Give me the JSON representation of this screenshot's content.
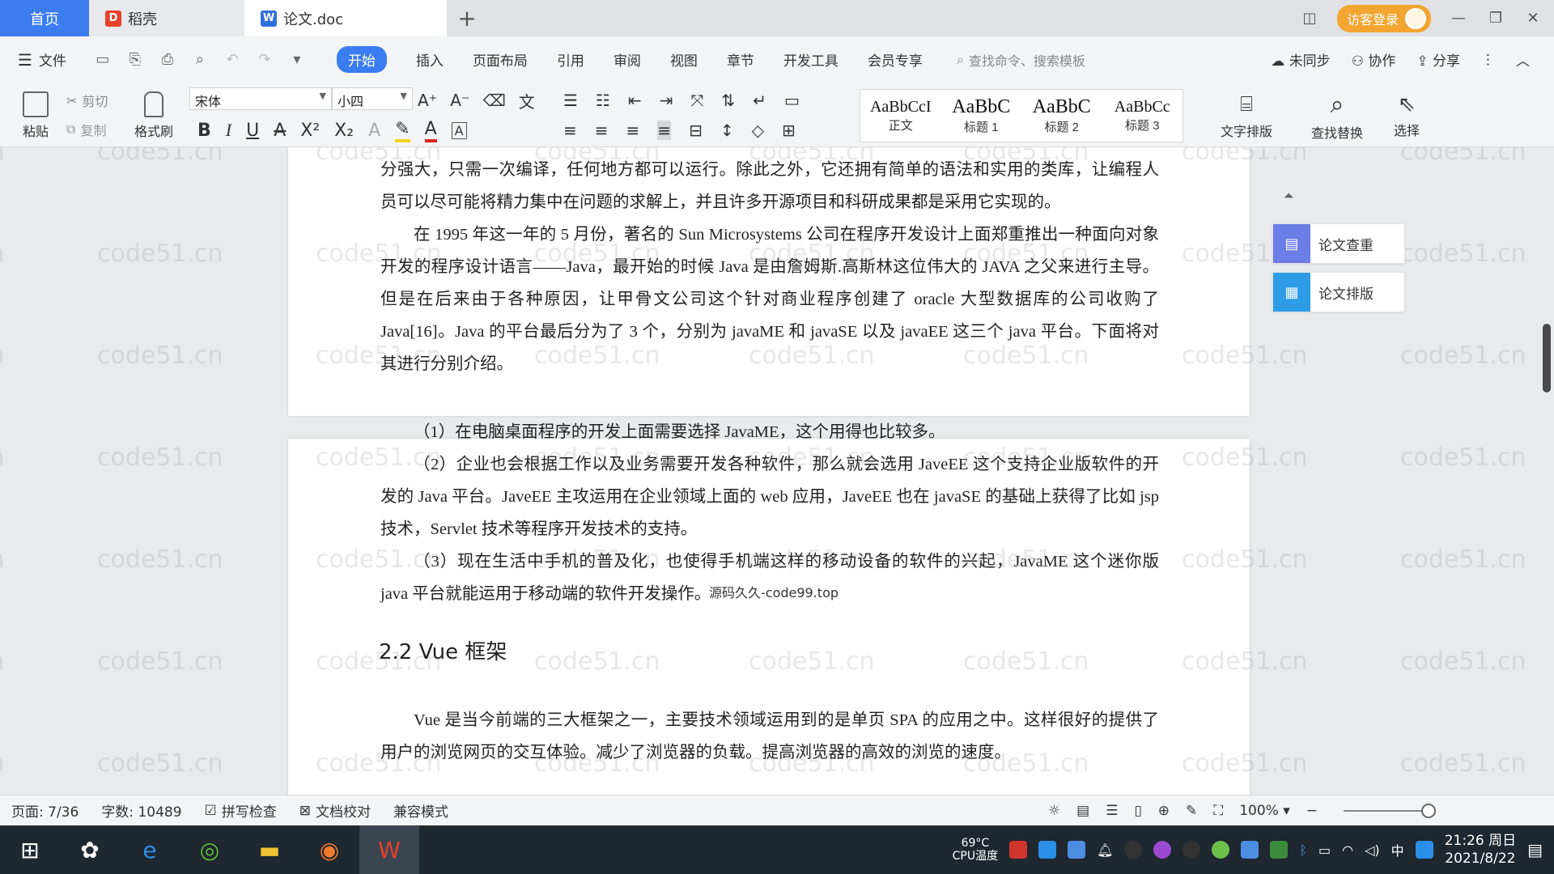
{
  "tabs": {
    "home": "首页",
    "daoke": "稻壳",
    "doc": "论文.doc"
  },
  "titlebar": {
    "login": "访客登录"
  },
  "menu": {
    "file": "文件",
    "items": [
      "开始",
      "插入",
      "页面布局",
      "引用",
      "审阅",
      "视图",
      "章节",
      "开发工具",
      "会员专享"
    ],
    "search_placeholder": "查找命令、搜索模板",
    "right": [
      "未同步",
      "协作",
      "分享"
    ]
  },
  "toolbar": {
    "paste": "粘贴",
    "cut": "剪切",
    "copy": "复制",
    "format_painter": "格式刷",
    "font_name": "宋体",
    "font_size": "小四",
    "styles": [
      {
        "preview": "AaBbCcI",
        "name": "正文"
      },
      {
        "preview": "AaBbC",
        "name": "标题 1"
      },
      {
        "preview": "AaBbC",
        "name": "标题 2"
      },
      {
        "preview": "AaBbCc",
        "name": "标题 3"
      }
    ],
    "text_layout": "文字排版",
    "find_replace": "查找替换",
    "select": "选择"
  },
  "side_panel": {
    "check": "论文查重",
    "layout": "论文排版"
  },
  "document": {
    "page_a_paragraphs": [
      "分强大，只需一次编译，任何地方都可以运行。除此之外，它还拥有简单的语法和实用的类库，让编程人员可以尽可能将精力集中在问题的求解上，并且许多开源项目和科研成果都是采用它实现的。",
      "在 1995 年这一年的 5 月份，著名的 Sun Microsystems 公司在程序开发设计上面郑重推出一种面向对象开发的程序设计语言——Java，最开始的时候 Java 是由詹姆斯.高斯林这位伟大的 JAVA 之父来进行主导。但是在后来由于各种原因，让甲骨文公司这个针对商业程序创建了 oracle 大型数据库的公司收购了 Java[16]。Java 的平台最后分为了 3 个，分别为 javaME 和 javaSE 以及 javaEE 这三个 java 平台。下面将对其进行分别介绍。"
    ],
    "page_b_paragraphs": [
      "（1）在电脑桌面程序的开发上面需要选择 JavaME，这个用得也比较多。",
      "（2）企业也会根据工作以及业务需要开发各种软件，那么就会选用 JaveEE 这个支持企业版软件的开发的 Java 平台。JaveEE 主攻运用在企业领域上面的 web 应用，JaveEE 也在 javaSE 的基础上获得了比如 jsp 技术，Servlet 技术等程序开发技术的支持。",
      "（3）现在生活中手机的普及化，也使得手机端这样的移动设备的软件的兴起，JavaME 这个迷你版 java 平台就能运用于移动端的软件开发操作。"
    ],
    "heading": "2.2 Vue 框架",
    "after_heading": "Vue 是当今前端的三大框架之一，主要技术领域运用到的是单页 SPA 的应用之中。这样很好的提供了用户的浏览网页的交互体验。减少了浏览器的负载。提高浏览器的高效的浏览的速度。",
    "overlay_watermark": "源码久久-code99.top",
    "watermark": "code51.cn"
  },
  "statusbar": {
    "page": "页面: 7/36",
    "words": "字数: 10489",
    "spell": "拼写检查",
    "proof": "文档校对",
    "compat": "兼容模式",
    "zoom": "100%"
  },
  "taskbar": {
    "cpu_temp": "69°C",
    "cpu_label": "CPU温度",
    "ime": "中",
    "time": "21:26 周日",
    "date": "2021/8/22"
  },
  "colors": {
    "accent": "#3b7cf0",
    "login": "#f2a531",
    "taskbar": "#1f2730"
  }
}
